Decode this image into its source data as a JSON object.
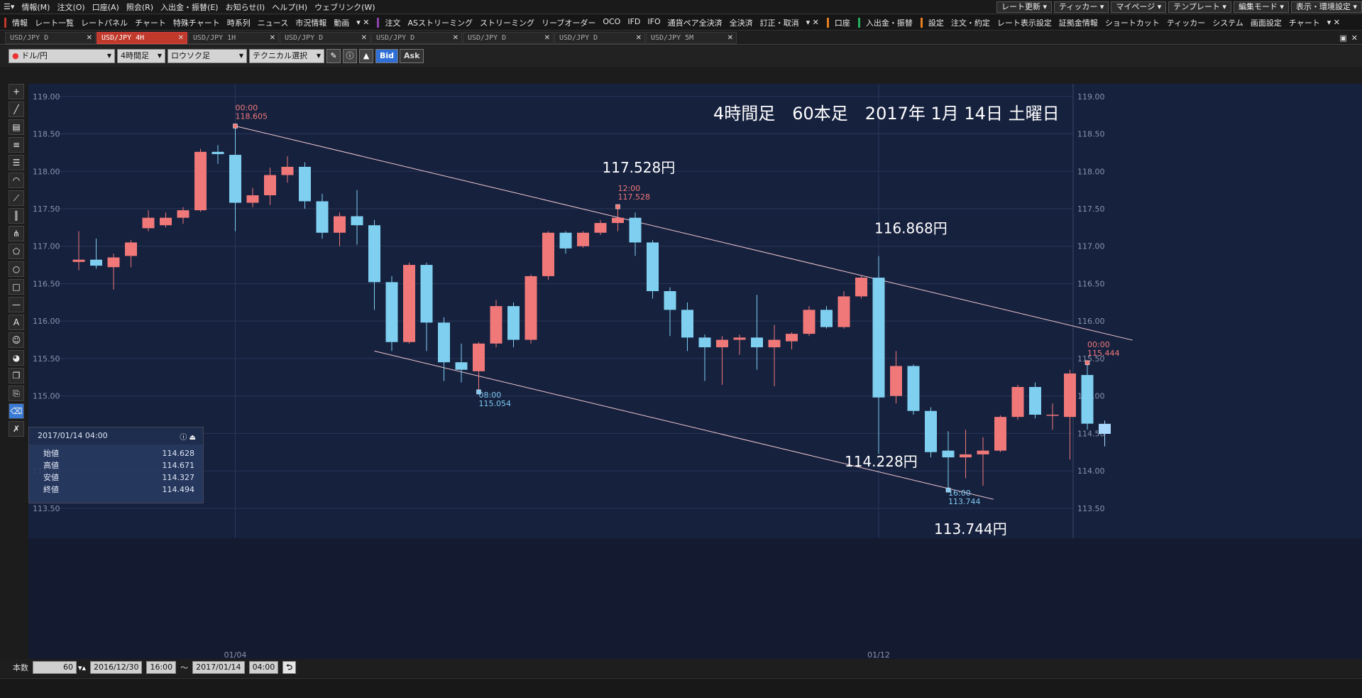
{
  "menu": {
    "items": [
      "情報(M)",
      "注文(O)",
      "口座(A)",
      "照会(R)",
      "入出金・振替(E)",
      "お知らせ(I)",
      "ヘルプ(H)",
      "ウェブリンク(W)"
    ],
    "right": [
      "レート更新",
      "ティッカー",
      "マイページ",
      "テンプレート",
      "編集モード",
      "表示・環境設定"
    ]
  },
  "toolbar": {
    "group1": [
      "情報",
      "レート一覧",
      "レートパネル",
      "チャート",
      "特殊チャート",
      "時系列",
      "ニュース",
      "市況情報",
      "動画"
    ],
    "group2": [
      "注文",
      "ASストリーミング",
      "ストリーミング",
      "リーブオーダー",
      "OCO",
      "IFD",
      "IFO",
      "通貨ペア全決済",
      "全決済",
      "訂正・取消"
    ],
    "account": "口座",
    "deposit": "入出金・振替",
    "group3": [
      "設定",
      "注文・約定",
      "レート表示設定",
      "証拠金情報",
      "ショートカット",
      "ティッカー",
      "システム",
      "画面設定",
      "チャート"
    ]
  },
  "tabs": [
    "USD/JPY D",
    "USD/JPY 4H",
    "USD/JPY 1H",
    "USD/JPY D",
    "USD/JPY D",
    "USD/JPY D",
    "USD/JPY D",
    "USD/JPY 5M"
  ],
  "active_tab": 1,
  "chartbar": {
    "pair": "ドル/円",
    "timeframe": "4時間足",
    "chart_style": "ロウソク足",
    "technical": "テクニカル選択",
    "bid": "Bid",
    "ask": "Ask"
  },
  "ohlc_panel": {
    "date": "2017/01/14 04:00",
    "rows": [
      {
        "label": "始値",
        "value": "114.628"
      },
      {
        "label": "高値",
        "value": "114.671"
      },
      {
        "label": "安値",
        "value": "114.327"
      },
      {
        "label": "終値",
        "value": "114.494"
      }
    ]
  },
  "bottombar": {
    "count_label": "本数",
    "count": "60",
    "from_date": "2016/12/30",
    "from_time": "16:00",
    "tilde": "～",
    "to_date": "2017/01/14",
    "to_time": "04:00"
  },
  "colors": {
    "up": "#f07878",
    "down": "#7fd0f0",
    "last": "#a8d8ff",
    "bg": "#16213e",
    "grid": "#2a3658",
    "trendline": "#f0c8d0",
    "marker_high": "#f07878",
    "marker_low": "#7fc8f0"
  },
  "chart_data": {
    "type": "candlestick",
    "title": "4時間足　60本足　2017年 1月 14日 土曜日",
    "ylim": [
      113.1,
      119.15
    ],
    "yticks": [
      "119.00",
      "118.50",
      "118.00",
      "117.50",
      "117.00",
      "116.50",
      "116.00",
      "115.50",
      "115.00",
      "114.50",
      "114.00",
      "113.50"
    ],
    "x_labels": [
      {
        "index": 9,
        "label": "01/04"
      },
      {
        "index": 46,
        "label": "01/12"
      }
    ],
    "candles": [
      [
        116.79,
        116.82,
        116.68,
        117.2
      ],
      [
        116.82,
        116.74,
        116.7,
        117.1
      ],
      [
        116.72,
        116.85,
        116.42,
        116.9
      ],
      [
        116.87,
        117.05,
        116.72,
        117.08
      ],
      [
        117.24,
        117.38,
        117.2,
        117.48
      ],
      [
        117.28,
        117.38,
        117.25,
        117.45
      ],
      [
        117.38,
        117.48,
        117.3,
        117.52
      ],
      [
        117.48,
        118.26,
        117.46,
        118.3
      ],
      [
        118.26,
        118.23,
        118.1,
        118.35
      ],
      [
        118.22,
        117.58,
        117.2,
        118.605
      ],
      [
        117.58,
        117.68,
        117.52,
        117.78
      ],
      [
        117.68,
        117.95,
        117.55,
        118.05
      ],
      [
        117.95,
        118.06,
        117.85,
        118.2
      ],
      [
        118.06,
        117.6,
        117.5,
        118.12
      ],
      [
        117.6,
        117.18,
        117.1,
        117.7
      ],
      [
        117.18,
        117.4,
        117.0,
        117.45
      ],
      [
        117.4,
        117.28,
        117.02,
        117.75
      ],
      [
        117.28,
        116.52,
        116.15,
        117.35
      ],
      [
        116.52,
        115.72,
        115.6,
        116.6
      ],
      [
        115.72,
        116.75,
        115.7,
        116.78
      ],
      [
        116.75,
        115.98,
        115.6,
        116.78
      ],
      [
        115.98,
        115.45,
        115.2,
        116.05
      ],
      [
        115.45,
        115.35,
        115.18,
        115.7
      ],
      [
        115.33,
        115.7,
        115.054,
        115.72
      ],
      [
        115.7,
        116.2,
        115.65,
        116.28
      ],
      [
        116.2,
        115.75,
        115.65,
        116.25
      ],
      [
        115.75,
        116.6,
        115.7,
        116.62
      ],
      [
        116.6,
        117.18,
        116.55,
        117.2
      ],
      [
        117.18,
        116.97,
        116.9,
        117.2
      ],
      [
        117.0,
        117.18,
        116.98,
        117.2
      ],
      [
        117.18,
        117.31,
        117.15,
        117.35
      ],
      [
        117.31,
        117.38,
        117.2,
        117.528
      ],
      [
        117.38,
        117.05,
        116.87,
        117.45
      ],
      [
        117.05,
        116.4,
        116.3,
        117.08
      ],
      [
        116.4,
        116.15,
        115.8,
        116.45
      ],
      [
        116.15,
        115.78,
        115.6,
        116.25
      ],
      [
        115.78,
        115.65,
        115.2,
        115.82
      ],
      [
        115.65,
        115.75,
        115.15,
        115.8
      ],
      [
        115.75,
        115.78,
        115.55,
        115.82
      ],
      [
        115.78,
        115.65,
        115.35,
        116.35
      ],
      [
        115.65,
        115.75,
        115.13,
        115.95
      ],
      [
        115.73,
        115.83,
        115.62,
        115.85
      ],
      [
        115.83,
        116.15,
        115.8,
        116.2
      ],
      [
        116.15,
        115.92,
        115.9,
        116.2
      ],
      [
        115.92,
        116.33,
        115.9,
        116.4
      ],
      [
        116.33,
        116.58,
        116.3,
        116.6
      ],
      [
        116.58,
        114.98,
        114.228,
        116.868
      ],
      [
        115.0,
        115.4,
        114.9,
        115.6
      ],
      [
        115.4,
        114.8,
        114.75,
        115.42
      ],
      [
        114.8,
        114.25,
        114.18,
        114.85
      ],
      [
        114.27,
        114.18,
        113.744,
        114.53
      ],
      [
        114.18,
        114.22,
        113.9,
        114.55
      ],
      [
        114.22,
        114.27,
        113.8,
        114.45
      ],
      [
        114.27,
        114.72,
        114.25,
        114.74
      ],
      [
        114.72,
        115.12,
        114.68,
        115.15
      ],
      [
        115.12,
        114.75,
        114.7,
        115.18
      ],
      [
        114.75,
        114.75,
        114.55,
        114.9
      ],
      [
        114.72,
        115.3,
        114.15,
        115.35
      ],
      [
        115.28,
        114.63,
        114.55,
        115.444
      ],
      [
        114.628,
        114.494,
        114.327,
        114.671
      ]
    ],
    "trendlines": [
      {
        "from": [
          9,
          118.605
        ],
        "to": [
          60.6,
          115.745
        ]
      },
      {
        "from": [
          17,
          115.6
        ],
        "to": [
          52.6,
          113.62
        ]
      }
    ],
    "markers": [
      {
        "index": 9,
        "value": 118.605,
        "time": "00:00",
        "price": "118.605",
        "kind": "high"
      },
      {
        "index": 31,
        "value": 117.528,
        "time": "12:00",
        "price": "117.528",
        "kind": "high"
      },
      {
        "index": 23,
        "value": 115.054,
        "time": "08:00",
        "price": "115.054",
        "kind": "low"
      },
      {
        "index": 50,
        "value": 113.744,
        "time": "16:00",
        "price": "113.744",
        "kind": "low"
      },
      {
        "index": 58,
        "value": 115.444,
        "time": "00:00",
        "price": "115.444",
        "kind": "high"
      }
    ],
    "annotations": [
      {
        "index": 31,
        "value": 117.528,
        "text": "117.528円"
      },
      {
        "index": 46,
        "value": 116.868,
        "text": "116.868円"
      },
      {
        "index": 46,
        "value": 114.228,
        "text": "114.228円"
      },
      {
        "index": 50,
        "value": 113.744,
        "text": "113.744円"
      }
    ]
  }
}
